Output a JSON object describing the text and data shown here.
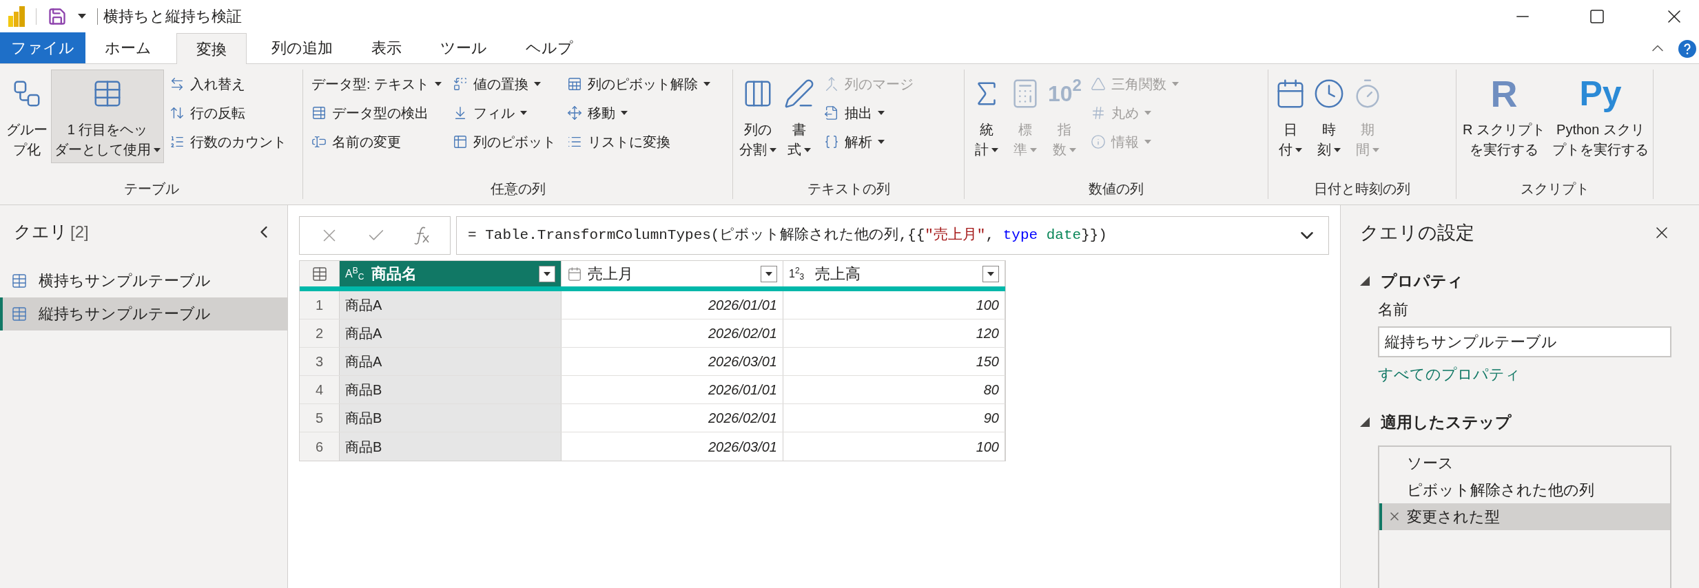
{
  "title_bar": {
    "title": "横持ちと縦持ち検証"
  },
  "tabs": [
    {
      "label": "ファイル",
      "kind": "file",
      "selected": false
    },
    {
      "label": "ホーム",
      "kind": "tab",
      "selected": false
    },
    {
      "label": "変換",
      "kind": "tab",
      "selected": true
    },
    {
      "label": "列の追加",
      "kind": "tab",
      "selected": false
    },
    {
      "label": "表示",
      "kind": "tab",
      "selected": false
    },
    {
      "label": "ツール",
      "kind": "tab",
      "selected": false
    },
    {
      "label": "ヘルプ",
      "kind": "tab",
      "selected": false
    }
  ],
  "ribbon": {
    "groups": [
      {
        "label": "テーブル",
        "items": [
          {
            "kind": "large",
            "lines": [
              "グルー",
              "プ化"
            ],
            "dropdown": false,
            "disabled": false,
            "hovered": false
          },
          {
            "kind": "large",
            "lines": [
              "1 行目をヘッ",
              "ダーとして使用"
            ],
            "dropdown": true,
            "disabled": false,
            "hovered": true
          },
          {
            "kind": "column",
            "items": [
              {
                "label": "入れ替え",
                "dropdown": false,
                "disabled": false
              },
              {
                "label": "行の反転",
                "dropdown": false,
                "disabled": false
              },
              {
                "label": "行数のカウント",
                "dropdown": false,
                "disabled": false
              }
            ]
          }
        ]
      },
      {
        "label": "任意の列",
        "items": [
          {
            "kind": "column",
            "items": [
              {
                "label": "データ型: テキスト",
                "dropdown": true,
                "disabled": false
              },
              {
                "label": "データ型の検出",
                "dropdown": false,
                "disabled": false
              },
              {
                "label": "名前の変更",
                "dropdown": false,
                "disabled": false
              }
            ]
          },
          {
            "kind": "column",
            "items": [
              {
                "label": "値の置換",
                "dropdown": true,
                "disabled": false
              },
              {
                "label": "フィル",
                "dropdown": true,
                "disabled": false
              },
              {
                "label": "列のピボット",
                "dropdown": false,
                "disabled": false
              }
            ]
          },
          {
            "kind": "column",
            "items": [
              {
                "label": "列のピボット解除",
                "dropdown": true,
                "disabled": false
              },
              {
                "label": "移動",
                "dropdown": true,
                "disabled": false
              },
              {
                "label": "リストに変換",
                "dropdown": false,
                "disabled": false
              }
            ]
          }
        ]
      },
      {
        "label": "テキストの列",
        "items": [
          {
            "kind": "large",
            "lines": [
              "列の",
              "分割"
            ],
            "dropdown": true,
            "disabled": false,
            "hovered": false
          },
          {
            "kind": "large",
            "lines": [
              "書",
              "式"
            ],
            "dropdown": true,
            "disabled": false,
            "hovered": false
          },
          {
            "kind": "column",
            "items": [
              {
                "label": "列のマージ",
                "dropdown": false,
                "disabled": true
              },
              {
                "label": "抽出",
                "dropdown": true,
                "disabled": false
              },
              {
                "label": "解析",
                "dropdown": true,
                "disabled": false
              }
            ]
          }
        ]
      },
      {
        "label": "数値の列",
        "items": [
          {
            "kind": "large",
            "lines": [
              "統",
              "計"
            ],
            "dropdown": true,
            "disabled": false,
            "hovered": false
          },
          {
            "kind": "large",
            "lines": [
              "標",
              "準"
            ],
            "dropdown": true,
            "disabled": true,
            "hovered": false
          },
          {
            "kind": "large",
            "lines": [
              "指",
              "数"
            ],
            "dropdown": true,
            "disabled": true,
            "hovered": false,
            "icon_text": "10$^{2}$"
          },
          {
            "kind": "column",
            "items": [
              {
                "label": "三角関数",
                "dropdown": true,
                "disabled": true
              },
              {
                "label": "丸め",
                "dropdown": true,
                "disabled": true
              },
              {
                "label": "情報",
                "dropdown": true,
                "disabled": true
              }
            ]
          }
        ]
      },
      {
        "label": "日付と時刻の列",
        "items": [
          {
            "kind": "large",
            "lines": [
              "日",
              "付"
            ],
            "dropdown": true,
            "disabled": false,
            "hovered": false
          },
          {
            "kind": "large",
            "lines": [
              "時",
              "刻"
            ],
            "dropdown": true,
            "disabled": false,
            "hovered": false
          },
          {
            "kind": "large",
            "lines": [
              "期",
              "間"
            ],
            "dropdown": true,
            "disabled": true,
            "hovered": false
          }
        ]
      },
      {
        "label": "スクリプト",
        "items": [
          {
            "kind": "large",
            "lines": [
              "R スクリプト",
              "を実行する"
            ],
            "dropdown": false,
            "disabled": false,
            "hovered": false,
            "icon_text": "R"
          },
          {
            "kind": "large",
            "lines": [
              "Python スクリ",
              "プトを実行する"
            ],
            "dropdown": false,
            "disabled": false,
            "hovered": false,
            "icon_text": "Py"
          }
        ]
      }
    ]
  },
  "queries": {
    "title": "クエリ",
    "count": "[2]",
    "items": [
      {
        "name": "横持ちサンプルテーブル",
        "selected": false
      },
      {
        "name": "縦持ちサンプルテーブル",
        "selected": true
      }
    ]
  },
  "formula_bar": {
    "tokens": [
      {
        "text": "= Table.TransformColumnTypes(ピボット解除された他の列,{{",
        "kind": "plain"
      },
      {
        "text": "\"売上月\"",
        "kind": "string"
      },
      {
        "text": ", ",
        "kind": "plain"
      },
      {
        "text": "type",
        "kind": "keyword"
      },
      {
        "text": " date",
        "kind": "type"
      },
      {
        "text": "}})",
        "kind": "plain"
      }
    ]
  },
  "table": {
    "columns": [
      {
        "name": "商品名",
        "kind": "text",
        "type_label": "A$^{B}$$_{C}$",
        "selected": true
      },
      {
        "name": "売上月",
        "kind": "date",
        "selected": false
      },
      {
        "name": "売上高",
        "kind": "number",
        "type_label": "1$^{2}$$_{3}$",
        "selected": false
      }
    ],
    "rows": [
      {
        "number": "1",
        "cells": [
          "商品A",
          "2026/01/01",
          "100"
        ]
      },
      {
        "number": "2",
        "cells": [
          "商品A",
          "2026/02/01",
          "120"
        ]
      },
      {
        "number": "3",
        "cells": [
          "商品A",
          "2026/03/01",
          "150"
        ]
      },
      {
        "number": "4",
        "cells": [
          "商品B",
          "2026/01/01",
          "80"
        ]
      },
      {
        "number": "5",
        "cells": [
          "商品B",
          "2026/02/01",
          "90"
        ]
      },
      {
        "number": "6",
        "cells": [
          "商品B",
          "2026/03/01",
          "100"
        ]
      }
    ]
  },
  "settings": {
    "title": "クエリの設定",
    "properties": {
      "heading": "プロパティ",
      "name_label": "名前",
      "name_value": "縦持ちサンプルテーブル",
      "link": "すべてのプロパティ"
    },
    "steps": {
      "heading": "適用したステップ",
      "items": [
        {
          "label": "ソース",
          "selected": false
        },
        {
          "label": "ピボット解除された他の列",
          "selected": false
        },
        {
          "label": "変更された型",
          "selected": true
        }
      ]
    }
  }
}
